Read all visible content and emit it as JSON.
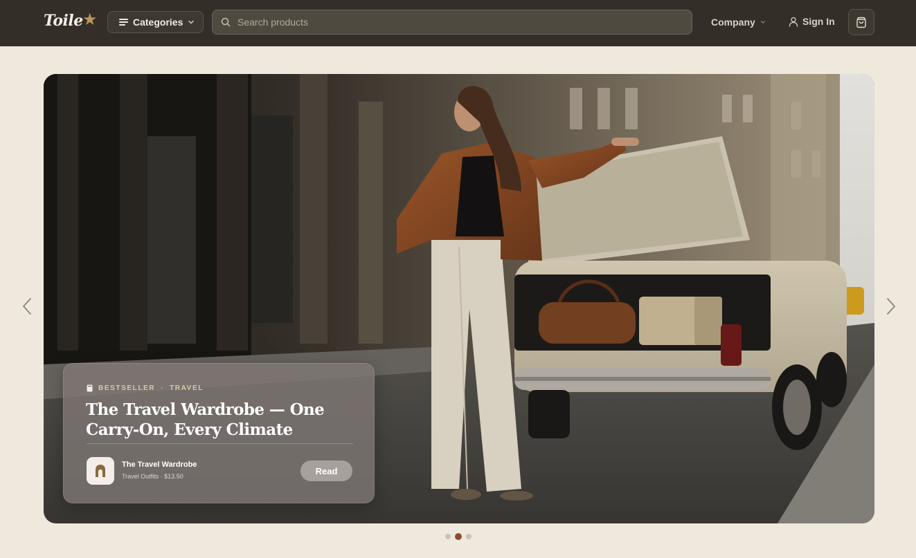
{
  "brand": {
    "name": "Toile",
    "star": "★"
  },
  "header": {
    "categories_label": "Categories",
    "search_placeholder": "Search products",
    "company_label": "Company",
    "signin_label": "Sign In",
    "icons": [
      "menu-icon",
      "chevron-down-icon",
      "search-icon",
      "user-icon",
      "shopping-bag-icon"
    ]
  },
  "hero": {
    "image_alt": "Woman in brown jacket and cream trousers beside a vintage car with open trunk holding luggage",
    "card": {
      "eyebrow_tag": "BESTSELLER",
      "eyebrow_separator": "·",
      "eyebrow_category": "TRAVEL",
      "title": "The Travel Wardrobe — One Carry-On, Every Climate",
      "product_name": "The Travel Wardrobe",
      "product_meta": "Travel Outfits · $13.50",
      "read_label": "Read"
    },
    "carousel": {
      "slides": 3,
      "active_index": 1
    }
  },
  "colors": {
    "header_bg": "#332f28",
    "page_bg": "#efe9dd",
    "accent_gold": "#b8975a",
    "active_dot": "#8a4d30"
  }
}
